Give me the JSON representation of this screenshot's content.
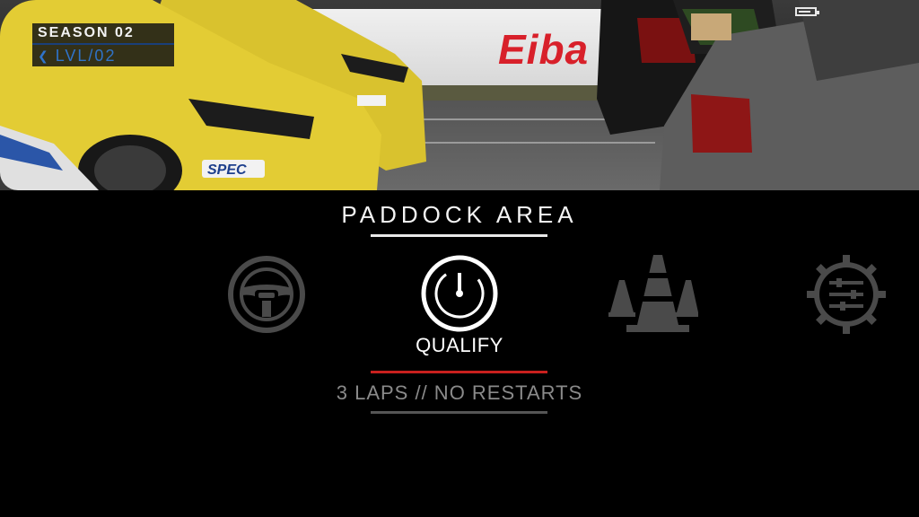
{
  "hud": {
    "season_label": "SEASON 02",
    "level_label": "LVL/02",
    "battery_level": 0.8
  },
  "hero": {
    "sponsor_text": "Eiba"
  },
  "menu": {
    "title": "PADDOCK AREA",
    "selected_label": "QUALIFY",
    "description": "3 LAPS // NO RESTARTS",
    "items": [
      {
        "name": "steering-wheel-icon",
        "selected": false
      },
      {
        "name": "stopwatch-icon",
        "selected": true
      },
      {
        "name": "traffic-cones-icon",
        "selected": false
      },
      {
        "name": "settings-gear-icon",
        "selected": false
      }
    ]
  },
  "colors": {
    "accent_red": "#c8201e",
    "level_blue": "#2f73c9",
    "inactive_icon": "#4a4a4a"
  }
}
